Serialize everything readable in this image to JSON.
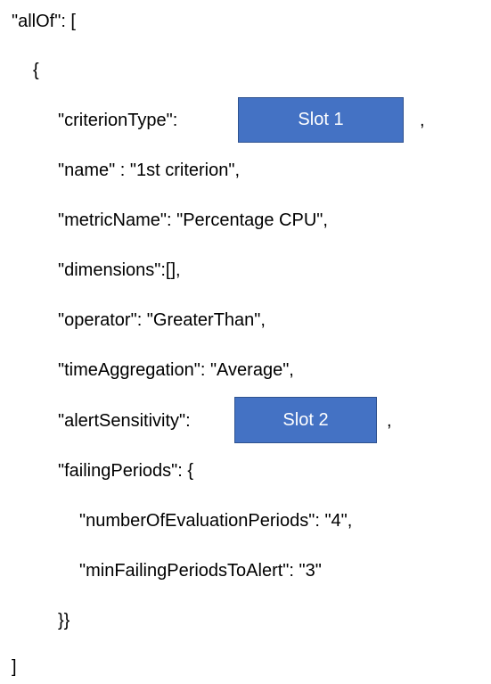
{
  "lines": {
    "allof_open": "\"allOf\": [",
    "brace_open": "{",
    "criterion_type_key": "\"criterionType\":",
    "name": "\"name\" : \"1st criterion\",",
    "metric_name": "\"metricName\": \"Percentage CPU\",",
    "dimensions": "\"dimensions\":[],",
    "operator": "\"operator\": \"GreaterThan\",",
    "time_aggregation": "\"timeAggregation\": \"Average\",",
    "alert_sensitivity_key": "\"alertSensitivity\":",
    "failing_periods_open": "\"failingPeriods\": {",
    "number_of_evaluation_periods": "\"numberOfEvaluationPeriods\": \"4\",",
    "min_failing_periods": "\"minFailingPeriodsToAlert\": \"3\"",
    "double_brace_close": "}}",
    "bracket_close": "]"
  },
  "slots": {
    "slot1_label": "Slot 1",
    "slot2_label": "Slot 2",
    "comma": ","
  },
  "colors": {
    "slot_fill": "#4472c4",
    "slot_border": "#2f528f",
    "slot_text": "#ffffff",
    "text": "#000000",
    "background": "#ffffff"
  }
}
